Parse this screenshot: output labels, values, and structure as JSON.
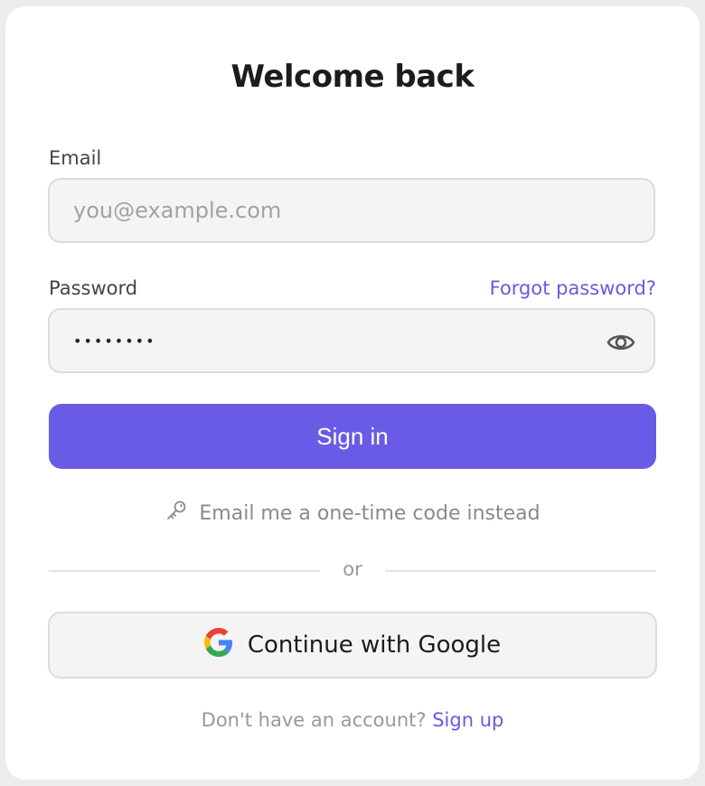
{
  "card": {
    "title": "Welcome back"
  },
  "email": {
    "label": "Email",
    "placeholder": "you@example.com",
    "value": ""
  },
  "password": {
    "label": "Password",
    "forgot_link": "Forgot password?",
    "value": "password",
    "visibility_icon": "eye-icon"
  },
  "signin_button": {
    "label": "Sign in"
  },
  "otp_link": {
    "label": "Email me a one-time code instead",
    "icon": "key-icon"
  },
  "divider": {
    "label": "or"
  },
  "google_button": {
    "label": "Continue with Google",
    "icon": "google-icon"
  },
  "footer": {
    "prompt": "Don't have an account?",
    "signup_link": "Sign up"
  },
  "colors": {
    "accent": "#6a5be6",
    "link": "#6a5ae0",
    "field_bg": "#f4f4f4",
    "border": "#dcdcdc"
  }
}
